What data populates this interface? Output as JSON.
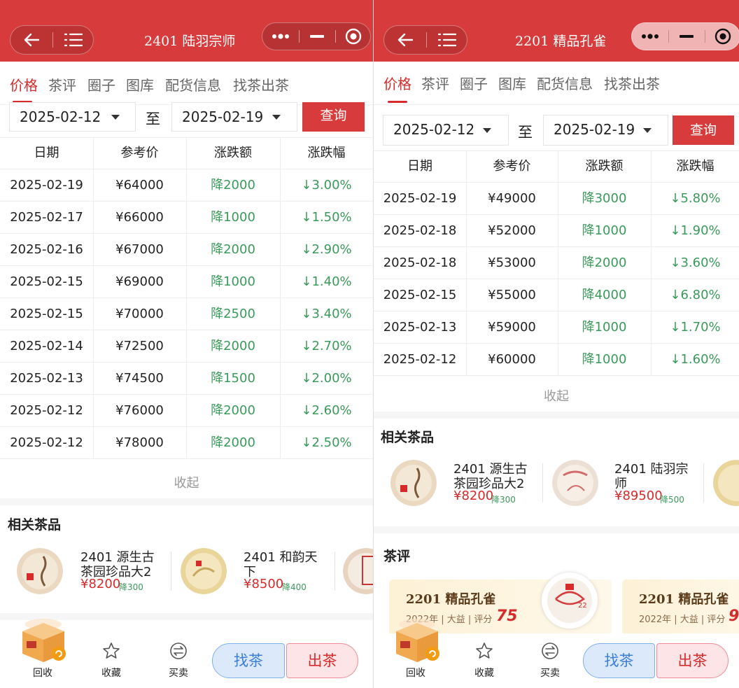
{
  "left": {
    "title": "2401 陆羽宗师",
    "tabs": [
      "价格",
      "茶评",
      "圈子",
      "图库",
      "配货信息",
      "找茶出茶"
    ],
    "date_from": "2025-02-12",
    "date_to": "2025-02-19",
    "to_label": "至",
    "query_label": "查询",
    "columns": [
      "日期",
      "参考价",
      "涨跌额",
      "涨跌幅"
    ],
    "rows": [
      [
        "2025-02-19",
        "¥64000",
        "降2000",
        "↓3.00%"
      ],
      [
        "2025-02-17",
        "¥66000",
        "降1000",
        "↓1.50%"
      ],
      [
        "2025-02-16",
        "¥67000",
        "降2000",
        "↓2.90%"
      ],
      [
        "2025-02-15",
        "¥69000",
        "降1000",
        "↓1.40%"
      ],
      [
        "2025-02-15",
        "¥70000",
        "降2500",
        "↓3.40%"
      ],
      [
        "2025-02-14",
        "¥72500",
        "降2000",
        "↓2.70%"
      ],
      [
        "2025-02-13",
        "¥74500",
        "降1500",
        "↓2.00%"
      ],
      [
        "2025-02-12",
        "¥76000",
        "降2000",
        "↓2.60%"
      ],
      [
        "2025-02-12",
        "¥78000",
        "降2000",
        "↓2.50%"
      ]
    ],
    "collapse_label": "收起",
    "related_title": "相关茶品",
    "related": [
      {
        "name": "2401 源生古茶园珍品大2",
        "price": "¥8200",
        "drop": "降300"
      },
      {
        "name": "2401 和韵天下",
        "price": "¥8500",
        "drop": "降400"
      }
    ]
  },
  "right": {
    "title": "2201 精品孔雀",
    "tabs": [
      "价格",
      "茶评",
      "圈子",
      "图库",
      "配货信息",
      "找茶出茶"
    ],
    "date_from": "2025-02-12",
    "date_to": "2025-02-19",
    "to_label": "至",
    "query_label": "查询",
    "columns": [
      "日期",
      "参考价",
      "涨跌额",
      "涨跌幅"
    ],
    "rows": [
      [
        "2025-02-19",
        "¥49000",
        "降3000",
        "↓5.80%"
      ],
      [
        "2025-02-18",
        "¥52000",
        "降1000",
        "↓1.90%"
      ],
      [
        "2025-02-18",
        "¥53000",
        "降2000",
        "↓3.60%"
      ],
      [
        "2025-02-15",
        "¥55000",
        "降4000",
        "↓6.80%"
      ],
      [
        "2025-02-13",
        "¥59000",
        "降1000",
        "↓1.70%"
      ],
      [
        "2025-02-12",
        "¥60000",
        "降1000",
        "↓1.60%"
      ]
    ],
    "collapse_label": "收起",
    "related_title": "相关茶品",
    "related": [
      {
        "name": "2401 源生古茶园珍品大2",
        "price": "¥8200",
        "drop": "降300"
      },
      {
        "name": "2401 陆羽宗师",
        "price": "¥89500",
        "drop": "降500"
      }
    ],
    "review_title": "茶评",
    "reviews": [
      {
        "name": "2201 精品孔雀",
        "meta": "2022年 | 大益 | 评分",
        "score": "75"
      },
      {
        "name": "2201 精品孔雀",
        "meta": "2022年 | 大益 | 评分",
        "score": "9"
      }
    ]
  },
  "bottom": {
    "recycle": "回收",
    "favorite": "收藏",
    "trade": "买卖",
    "find": "找茶",
    "sell": "出茶"
  },
  "colors": {
    "brand": "#d83b3b",
    "up_down": "#3a9a5a",
    "price": "#d72a2a"
  }
}
